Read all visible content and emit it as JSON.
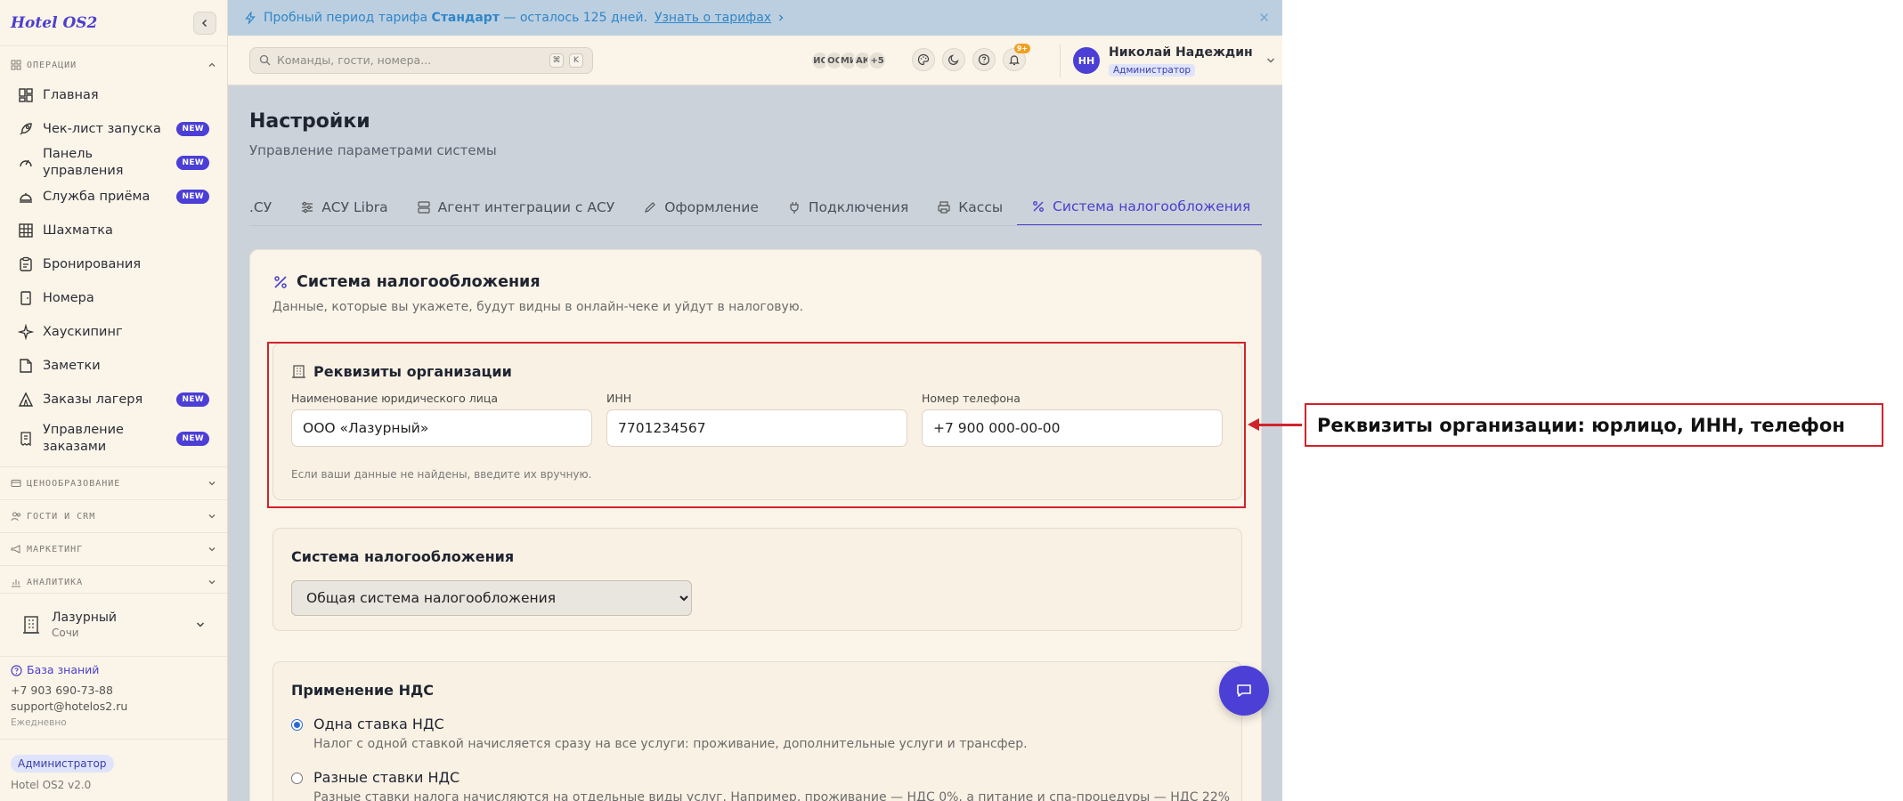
{
  "brand": {
    "logo": "Hotel OS2",
    "accent": "#4b3fd6"
  },
  "sidebar": {
    "sections": {
      "operations": "ОПЕРАЦИИ",
      "pricing": "ЦЕНООБРАЗОВАНИЕ",
      "guests": "ГОСТИ И CRM",
      "marketing": "МАРКЕТИНГ",
      "analytics": "АНАЛИТИКА"
    },
    "items": [
      {
        "label": "Главная",
        "icon": "dashboard-icon"
      },
      {
        "label": "Чек-лист запуска",
        "badge": "NEW",
        "icon": "rocket-icon"
      },
      {
        "label": "Панель управления",
        "badge": "NEW",
        "icon": "gauge-icon"
      },
      {
        "label": "Служба приёма",
        "badge": "NEW",
        "icon": "bell-concierge-icon"
      },
      {
        "label": "Шахматка",
        "icon": "grid-icon"
      },
      {
        "label": "Бронирования",
        "icon": "clipboard-icon"
      },
      {
        "label": "Номера",
        "icon": "door-icon"
      },
      {
        "label": "Хаускипинг",
        "icon": "sparkle-icon"
      },
      {
        "label": "Заметки",
        "icon": "note-icon"
      },
      {
        "label": "Заказы лагеря",
        "badge": "NEW",
        "icon": "tent-icon"
      },
      {
        "label": "Управление заказами",
        "badge": "NEW",
        "icon": "receipt-icon"
      }
    ],
    "hotel": {
      "name": "Лазурный",
      "city": "Сочи"
    },
    "help": {
      "knowledge_base": "База знаний",
      "phone": "+7 903 690-73-88",
      "email": "support@hotelos2.ru",
      "schedule": "Ежедневно"
    },
    "role": "Администратор",
    "version": "Hotel OS2 v2.0"
  },
  "banner": {
    "prefix": "Пробный период тарифа",
    "plan": "Стандарт",
    "suffix": "— осталось 125 дней.",
    "link": "Узнать о тарифах"
  },
  "topbar": {
    "search_placeholder": "Команды, гости, номера...",
    "search_shortcut_1": "⌘",
    "search_shortcut_2": "K",
    "avatars": [
      "ИС",
      "ОС",
      "МИ",
      "АК",
      "+5"
    ],
    "notifications_count": "9+",
    "user": {
      "initials": "НН",
      "name": "Николай Надеждин",
      "role": "Администратор"
    }
  },
  "page": {
    "title": "Настройки",
    "subtitle": "Управление параметрами системы",
    "tabs": [
      {
        "label": ".СУ"
      },
      {
        "label": "АСУ Libra"
      },
      {
        "label": "Агент интеграции с АСУ"
      },
      {
        "label": "Оформление"
      },
      {
        "label": "Подключения"
      },
      {
        "label": "Кассы"
      },
      {
        "label": "Система налогообложения",
        "active": true
      }
    ]
  },
  "tax": {
    "title": "Система налогообложения",
    "description": "Данные, которые вы укажете, будут видны в онлайн-чеке и уйдут в налоговую.",
    "org": {
      "title": "Реквизиты организации",
      "legal_name_label": "Наименование юридического лица",
      "legal_name_value": "ООО «Лазурный»",
      "inn_label": "ИНН",
      "inn_value": "7701234567",
      "phone_label": "Номер телефона",
      "phone_value": "+7 900 000-00-00",
      "hint": "Если ваши данные не найдены, введите их вручную."
    },
    "system": {
      "title": "Система налогообложения",
      "selected": "Общая система налогообложения"
    },
    "vat": {
      "title": "Применение НДС",
      "options": [
        {
          "label": "Одна ставка НДС",
          "desc": "Налог с одной ставкой начисляется сразу на все услуги: проживание, дополнительные услуги и трансфер.",
          "checked": true
        },
        {
          "label": "Разные ставки НДС",
          "desc": "Разные ставки налога начисляются на отдельные виды услуг. Например, проживание — НДС 0%, а питание и спа-процедуры — НДС 22%",
          "checked": false
        }
      ]
    }
  },
  "annotation": {
    "text": "Реквизиты организации: юрлицо, ИНН, телефон",
    "color": "#d1232b"
  }
}
